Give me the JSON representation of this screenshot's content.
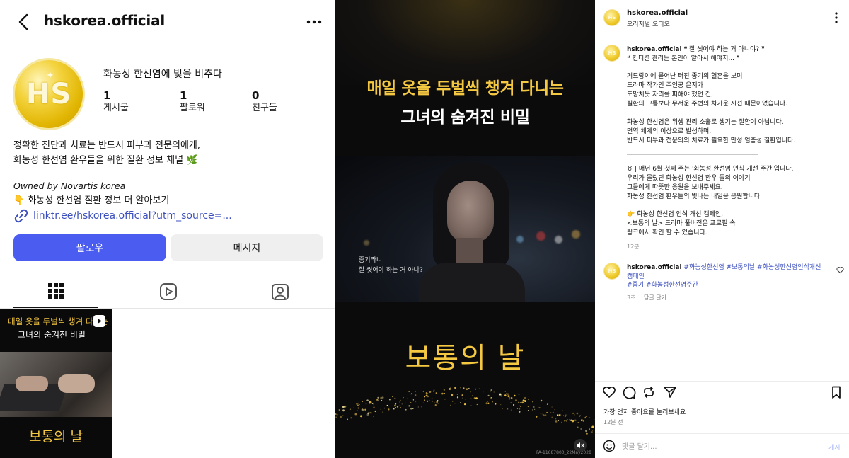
{
  "profile": {
    "handle": "hskorea.official",
    "avatar_text": "HS",
    "display_name": "화농성 한선염에 빛을 비추다",
    "stats": [
      {
        "value": "1",
        "label": "게시물"
      },
      {
        "value": "1",
        "label": "팔로워"
      },
      {
        "value": "0",
        "label": "친구들"
      }
    ],
    "bio_line1": "정확한 진단과 치료는 반드시 피부과 전문의에게,",
    "bio_line2": "화농성 한선염 환우들을 위한 질환 정보 채널 🌿",
    "owned_by": "Owned by Novartis korea",
    "more_info": "👇 화농성 한선염 질환 정보 더 알아보기",
    "link": "linktr.ee/hskorea.official?utm_source=...",
    "follow_button": "팔로우",
    "message_button": "메시지",
    "tabs": [
      "grid-icon",
      "reels-icon",
      "tagged-icon"
    ],
    "thumbnail": {
      "line1": "매일 옷을 두벌씩 챙겨 다니는",
      "line2": "그녀의 숨겨진 비밀",
      "title": "보통의 날"
    }
  },
  "reel": {
    "headline1": "매일 옷을 두벌씩 챙겨 다니는",
    "headline2": "그녀의 숨겨진 비밀",
    "subtitle1": "종기라니",
    "subtitle2": "잘 씻어야 하는 거 아냐?",
    "title": "보통의 날",
    "code": "FA-11687800_22May2028",
    "accent_color": "#f5c842"
  },
  "comments": {
    "header_name": "hskorea.official",
    "header_sub": "오리지널 오디오",
    "caption": {
      "author": "hskorea.official",
      "line1": "❝ 잘 씻어야 하는 거 아니야? ❞",
      "line2": "❝ 컨디션 관리는 본인이 알아서 해야지... ❞",
      "para1": [
        "겨드랑이에 묻어난 터진 종기의 혈흔을 보며",
        "드라마 작가인 주인공 은지가",
        "도망치듯 자리를 피해야 했던 건,",
        "질환의 고통보다 무서운 주변의 차가운 시선 때문이었습니다."
      ],
      "para2": [
        "화농성 한선염은 위생 관리 소홀로 생기는 질환이 아닙니다.",
        "면역 체계의 이상으로 발생하며,",
        "반드시 피부과 전문의의 치료가 필요한 만성 염증성 질환입니다."
      ],
      "para3": [
        "♉ | 매년 6월 첫째 주는 '화농성 한선염 인식 개선 주간'입니다.",
        "우리가 몰랐던 화농성 한선염 환우 들의 이야기",
        "그들에게 따뜻한 응원을 보내주세요.",
        "화농성 한선염 환우들의 빛나는 내일을 응원합니다."
      ],
      "para4": [
        "👉 화농성 한선염 인식 개선 캠페인,",
        "<보통의 날> 드라마 풀버전은 프로필 속",
        "링크에서 확인 할 수 있습니다."
      ],
      "time": "12분"
    },
    "reply": {
      "author": "hskorea.official",
      "tags_line1": "#화농성한선염 #보통의날 #화농성한선염인식개선",
      "tags_line2": "캠페인",
      "tags_line3": "#종기 #화농성한선염주간",
      "time": "3초",
      "reply_label": "답글 달기"
    },
    "like_first": "가장 먼저 좋아요를 눌러보세요",
    "post_time": "12분 전",
    "comment_placeholder": "댓글 달기...",
    "post_button": "게시",
    "post_color": "#9fb0f5"
  }
}
